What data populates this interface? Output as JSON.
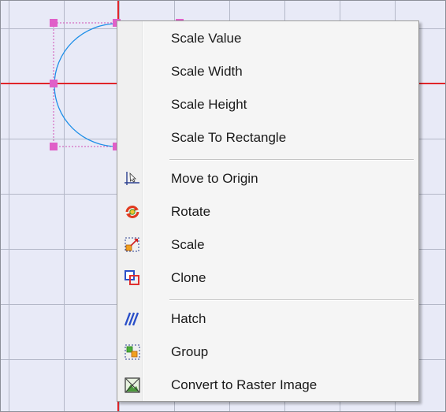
{
  "menu": {
    "items": [
      {
        "label": "Scale Value",
        "icon": "none"
      },
      {
        "label": "Scale Width",
        "icon": "none"
      },
      {
        "label": "Scale Height",
        "icon": "none"
      },
      {
        "label": "Scale To Rectangle",
        "icon": "none"
      },
      {
        "label": "Move to Origin",
        "icon": "move-to-origin-icon"
      },
      {
        "label": "Rotate",
        "icon": "rotate-icon"
      },
      {
        "label": "Scale",
        "icon": "scale-icon"
      },
      {
        "label": "Clone",
        "icon": "clone-icon"
      },
      {
        "label": "Hatch",
        "icon": "hatch-icon"
      },
      {
        "label": "Group",
        "icon": "group-icon"
      },
      {
        "label": "Convert to Raster Image",
        "icon": "convert-to-raster-icon"
      }
    ]
  },
  "colors": {
    "canvas_bg": "#e8eaf7",
    "grid_line": "#b4b8c8",
    "axis": "#e0252a",
    "selection_handle": "#e060c8",
    "shape_stroke": "#1e8fe8"
  }
}
